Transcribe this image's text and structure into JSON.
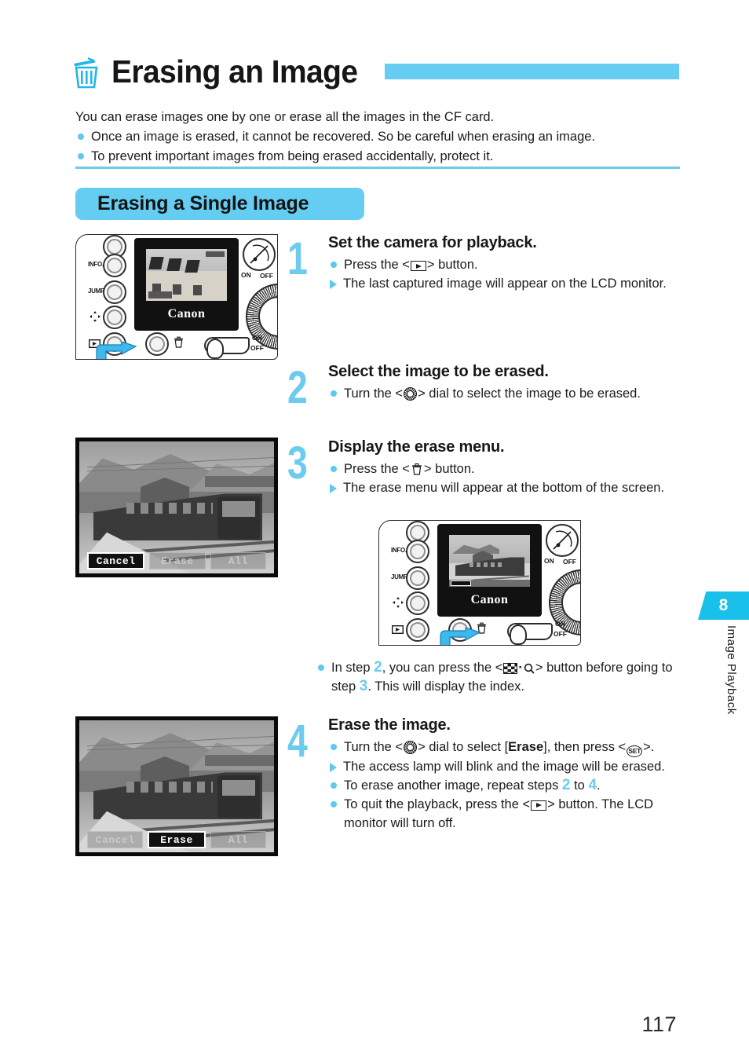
{
  "header": {
    "icon": "trash-icon",
    "title": "Erasing an Image",
    "accent_color": "#66cdf2"
  },
  "intro": {
    "lead": "You can erase images one by one or erase all the images in the CF card.",
    "bullets": [
      "Once an image is erased, it cannot be recovered. So be careful when erasing an image.",
      "To prevent important images from being erased accidentally, protect it."
    ]
  },
  "section": {
    "title": "Erasing a Single Image"
  },
  "steps": [
    {
      "number": "1",
      "title": "Set the camera for playback.",
      "lines": [
        {
          "marker": "dot",
          "pre": "Press the <",
          "icon": "playback-icon",
          "post": "> button."
        },
        {
          "marker": "tri",
          "pre": "The last captured image will appear on the LCD monitor.",
          "icon": "",
          "post": ""
        }
      ]
    },
    {
      "number": "2",
      "title": "Select the image to be erased.",
      "lines": [
        {
          "marker": "dot",
          "pre": "Turn the <",
          "icon": "dial-icon",
          "post": "> dial to select the image to be erased."
        }
      ]
    },
    {
      "number": "3",
      "title": "Display the erase menu.",
      "lines": [
        {
          "marker": "dot",
          "pre": "Press the <",
          "icon": "trash-icon",
          "post": "> button."
        },
        {
          "marker": "tri",
          "pre": "The erase menu will appear at the bottom of the screen.",
          "icon": "",
          "post": ""
        }
      ]
    },
    {
      "number": "4",
      "title": "Erase the image.",
      "lines": [
        {
          "marker": "dot",
          "pre": "Turn the <",
          "icon": "dial-icon",
          "post": "> dial to select [Erase], then press <SET>."
        },
        {
          "marker": "tri",
          "pre": "The access lamp will blink and the image will be erased.",
          "icon": "",
          "post": ""
        },
        {
          "marker": "dot",
          "pre": "To erase another image, repeat steps 2 to 4.",
          "icon": "",
          "post": ""
        },
        {
          "marker": "dot",
          "pre": "To quit the playback, press the <",
          "icon": "playback-icon",
          "post": "> button. The LCD monitor will turn off."
        }
      ]
    }
  ],
  "step1_line1": {
    "pre": "Press the <",
    "post": "> button."
  },
  "step1_line2": "The last captured image will appear on the LCD monitor.",
  "step2_line1": {
    "pre": "Turn the <",
    "post": "> dial to select the image to be erased."
  },
  "step3_line1": {
    "pre": "Press the <",
    "post": "> button."
  },
  "step3_line2": "The erase menu will appear at the bottom of the screen.",
  "index_note": {
    "pre": "In step ",
    "step_a": "2",
    "mid": ", you can press the <",
    "post": "> button before going to step ",
    "step_b": "3",
    "tail": ". This will display the index."
  },
  "step4": {
    "line1_pre": "Turn the <",
    "line1_mid": "> dial to select [",
    "line1_bold": "Erase",
    "line1_post": "], then press <",
    "line1_tail": ">.",
    "set_label": "SET",
    "line2": "The access lamp will blink and the image will be erased.",
    "line3_pre": "To erase another image, repeat steps ",
    "line3_a": "2",
    "line3_mid": " to ",
    "line3_b": "4",
    "line3_post": ".",
    "line4_pre": "To quit the playback, press the <",
    "line4_post": "> button. The LCD monitor will turn off."
  },
  "camera_diagram": {
    "buttons": [
      "INFO.",
      "JUMP"
    ],
    "power_on": "ON",
    "power_off": "OFF",
    "mode_on": "ON",
    "mode_off": "OFF",
    "brand": "Canon"
  },
  "erase_menu": {
    "items": [
      "Cancel",
      "Erase",
      "All"
    ],
    "selected_step3": "Cancel",
    "selected_step4": "Erase"
  },
  "side_tab": {
    "chapter": "8",
    "label": "Image Playback"
  },
  "footer": {
    "page_number": "117"
  }
}
